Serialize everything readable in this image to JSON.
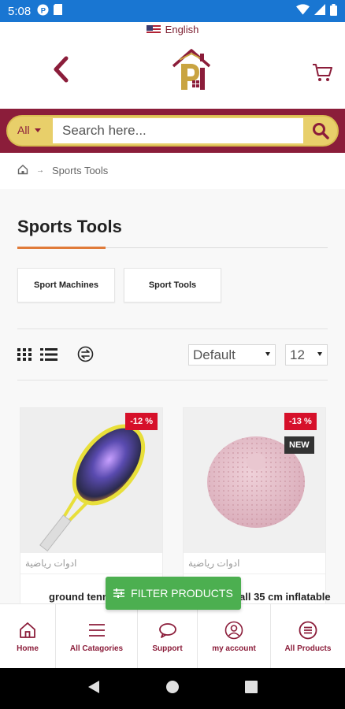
{
  "status_bar": {
    "time": "5:08",
    "icons_left": [
      "p-icon",
      "sim-icon"
    ],
    "icons_right": [
      "wifi-icon",
      "signal-icon",
      "battery-icon"
    ]
  },
  "header": {
    "language": "English",
    "back_icon": "chevron-left-icon",
    "logo": "brand-logo-house",
    "cart_icon": "cart-icon"
  },
  "search": {
    "category": "All",
    "placeholder": "Search here...",
    "button_icon": "search-icon"
  },
  "breadcrumb": {
    "home_icon": "home-icon",
    "separator": "→",
    "current": "Sports Tools"
  },
  "page": {
    "title": "Sports Tools"
  },
  "categories": [
    {
      "label": "Sport Machines"
    },
    {
      "label": "Sport Tools"
    }
  ],
  "toolbar": {
    "sort": "Default",
    "per_page": "12"
  },
  "products": [
    {
      "category": "ادوات رياضية",
      "name": "ground tenn",
      "discount": "-12 %",
      "image": "tennis-racket"
    },
    {
      "category": "ادوات رياضية",
      "name": "all 35 cm inflatable",
      "discount": "-13 %",
      "new_badge": "NEW",
      "image": "pink-balance-pad"
    }
  ],
  "filter": {
    "label": "FILTER PRODUCTS"
  },
  "bottom_nav": [
    {
      "label": "Home",
      "icon": "home-icon"
    },
    {
      "label": "All Catagories",
      "icon": "menu-icon"
    },
    {
      "label": "Support",
      "icon": "chat-icon"
    },
    {
      "label": "my account",
      "icon": "user-icon"
    },
    {
      "label": "All Products",
      "icon": "list-circle-icon"
    }
  ],
  "colors": {
    "brand": "#8b1d3a",
    "gold": "#e8cf6a",
    "accent": "#e07b39",
    "sale": "#d6102a",
    "filter": "#4caf50",
    "status_bar": "#1976d2"
  }
}
